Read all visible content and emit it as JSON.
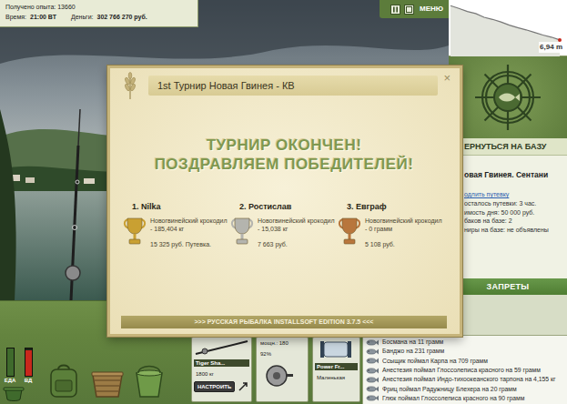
{
  "stats": {
    "experience": "Получено опыта: 13660",
    "time_label": "Время:",
    "time": "21:00 ВТ",
    "money_label": "Деньги:",
    "money": "302 766 270 руб."
  },
  "toolbar": {
    "menu": "МЕНЮ"
  },
  "depth_chart": {
    "reading": "6,94 m",
    "profile": [
      0.4,
      0.9,
      1.5,
      1.9,
      2.6,
      3.0,
      3.5,
      4.1,
      4.6,
      5.0,
      5.5,
      6.0,
      6.4,
      6.94
    ]
  },
  "base": {
    "return_button": "ЕРНУТЬСЯ НА БАЗУ",
    "location": "овая Гвинея. Сентани",
    "extend_link": "одлить путевку",
    "details": [
      "осталось путевки: 3 час.",
      "имость дня: 50 000 руб.",
      "баков на базе: 2",
      "ниры на базе: не объявлены"
    ]
  },
  "bans": {
    "title": "ЗАПРЕТЫ"
  },
  "feed": [
    "Босмана на 11 грамм",
    "Банджо на 231 грамм",
    "Ссыщик поймал Карпа на 709 грамм",
    "Анестезия поймал Глоссолеписа красного на 59 грамм",
    "Анестезия поймал Индо-тихоокеанского тарпона на 4,155 кг",
    "Фриц поймал Радужницу Блехера на 20 грамм",
    "Глюк поймал Глоссолеписа красного на 90 грамм"
  ],
  "meters": [
    {
      "label": "ЕДА",
      "level": 1.0,
      "color": "#3f6a2c"
    },
    {
      "label": "ВД",
      "level": 0.95,
      "color": "#c8281c"
    }
  ],
  "inventory": {
    "rod": {
      "name": "Tiger Sha...",
      "load": "1800 кг",
      "button": "НАСТРОИТЬ"
    },
    "reel": {
      "power": "мощн.: 180",
      "wear": "92%"
    },
    "line": {
      "name": "Power Fr...",
      "hook": "Маленькая"
    }
  },
  "tournament": {
    "title": "1st Турнир Новая Гвинея - КВ",
    "close": "×",
    "headline": [
      "ТУРНИР ОКОНЧЕН!",
      "ПОЗДРАВЛЯЕМ ПОБЕДИТЕЛЕЙ!"
    ],
    "winners": [
      {
        "place": "1. Nilka",
        "catch": "Новогвинейский крокодил - 185,404 кг",
        "prize": "15 325 руб. Путевка.",
        "color": "#c9a032"
      },
      {
        "place": "2. Ростислав",
        "catch": "Новогвинейский крокодил - 15,038 кг",
        "prize": "7 663 руб.",
        "color": "#b4b4ae"
      },
      {
        "place": "3. Евграф",
        "catch": "Новогвинейский крокодил - 0 грамм",
        "prize": "5 108 руб.",
        "color": "#b8763c"
      }
    ],
    "footer": ">>> РУССКАЯ РЫБАЛКА INSTALLSOFT EDITION 3.7.5 <<<"
  }
}
